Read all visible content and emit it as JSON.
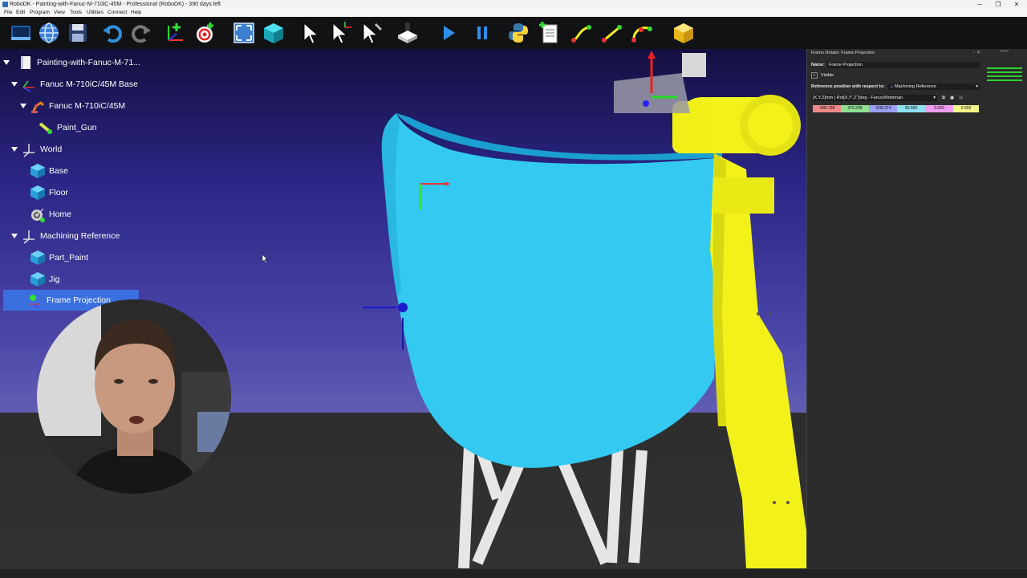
{
  "window": {
    "title": "RoboDK - Painting-with-Fanuc-M-710iC-45M - Professional (RoboDK) - 390 days left",
    "controls": [
      "─",
      "❐",
      "✕"
    ]
  },
  "menu": [
    "File",
    "Edit",
    "Program",
    "View",
    "Tools",
    "Utilities",
    "Connect",
    "Help"
  ],
  "toolbar": {
    "icons": [
      "open-station-icon",
      "web-library-icon",
      "save-icon",
      "undo-icon",
      "redo-icon",
      "add-frame-icon",
      "add-target-icon",
      "fit-all-icon",
      "isometric-view-icon",
      "select-icon",
      "move-reference-icon",
      "move-tool-icon",
      "export-simulation-icon",
      "play-icon",
      "pause-icon",
      "python-program-icon",
      "new-program-icon",
      "move-joint-icon",
      "move-linear-icon",
      "move-circular-icon",
      "pack-icon"
    ]
  },
  "tree": {
    "items": [
      {
        "label": "Painting-with-Fanuc-M-71...",
        "level": 0,
        "icon": "station-icon",
        "expanded": true
      },
      {
        "label": "Fanuc M-710iC/45M Base",
        "level": 1,
        "icon": "frame-icon",
        "expanded": true
      },
      {
        "label": "Fanuc M-710iC/45M",
        "level": 2,
        "icon": "robot-icon",
        "expanded": true
      },
      {
        "label": "Paint_Gun",
        "level": 3,
        "icon": "tool-icon"
      },
      {
        "label": "World",
        "level": 1,
        "icon": "frame-icon",
        "expanded": true
      },
      {
        "label": "Base",
        "level": 2,
        "icon": "object-icon"
      },
      {
        "label": "Floor",
        "level": 2,
        "icon": "object-icon"
      },
      {
        "label": "Home",
        "level": 2,
        "icon": "target-icon"
      },
      {
        "label": "Machining Reference",
        "level": 1,
        "icon": "frame-icon",
        "expanded": true
      },
      {
        "label": "Part_Paint",
        "level": 2,
        "icon": "object-icon"
      },
      {
        "label": "Jig",
        "level": 2,
        "icon": "object-icon"
      },
      {
        "label": "Frame Projection",
        "level": 2,
        "icon": "frame-small-icon",
        "selected": true
      }
    ]
  },
  "panel": {
    "title": "Frame Details: Frame Projection",
    "name_label": "Name:",
    "name_value": "Frame Projection",
    "visible_label": "Visible",
    "ref_label": "Reference position with respect to:",
    "ref_value": "Machining Reference",
    "format_value": "[X,Y,Z]mm | Rot[X,Y',Z'']deg - Fanuc/Motoman",
    "coords": [
      "-586.798",
      "479.298",
      "-838.374",
      "90.000",
      "0.000",
      "0.000"
    ],
    "coord_colors": [
      "#f28a8a",
      "#8fe08f",
      "#9aa0f5",
      "#8fe0f0",
      "#f09ff0",
      "#f5f58a"
    ]
  },
  "colors": {
    "selection": "#3b6fe0",
    "part": "#33c9f0",
    "robot": "#f2f21a"
  }
}
